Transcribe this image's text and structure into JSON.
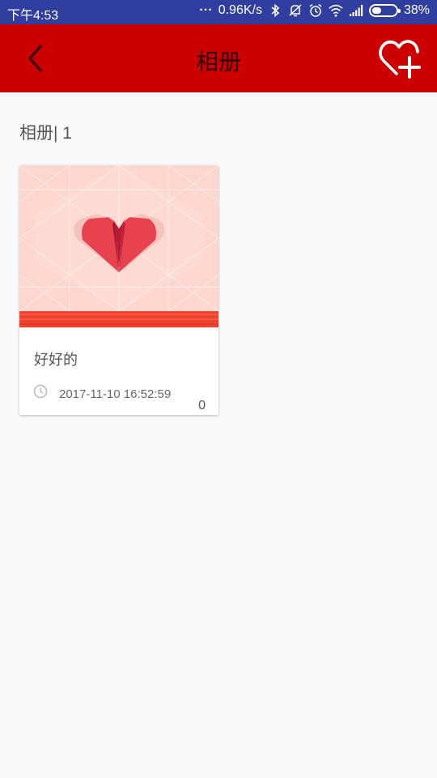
{
  "status_bar": {
    "time": "下午4:53",
    "dots": "...",
    "speed": "0.96K/s",
    "battery": "38%",
    "battery_level": 0.38,
    "icons": [
      "bluetooth-icon",
      "mute-icon",
      "alarm-icon",
      "wifi-icon",
      "signal-icon",
      "battery-icon"
    ]
  },
  "header": {
    "title": "相册",
    "background_color": "#cc0000",
    "icons": [
      "back-arrow-icon",
      "heart-plus-icon"
    ]
  },
  "album_count": "相册| 1",
  "albums": [
    {
      "name": "好好的",
      "date": "2017-11-10 16:52:59",
      "count": "0",
      "cover_icon": "origami-heart-icon"
    }
  ],
  "colors": {
    "status_bar": "#303f9f",
    "accent": "#cc0000",
    "background": "#f9f9f9"
  }
}
